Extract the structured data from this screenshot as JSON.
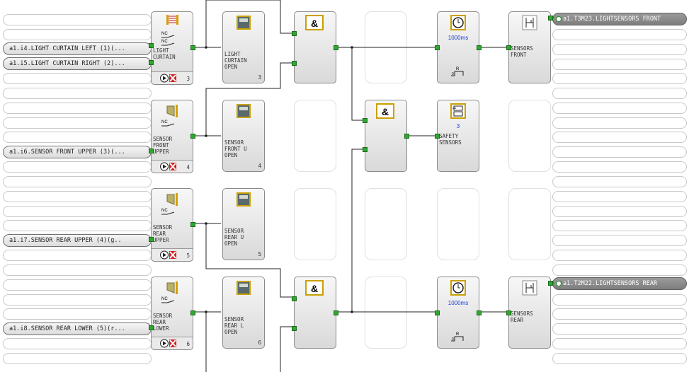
{
  "inputs": [
    {
      "label": "a1.i4.LIGHT CURTAIN LEFT  (1)(..."
    },
    {
      "label": "a1.i5.LIGHT CURTAIN RIGHT  (2)..."
    },
    {
      "label": "a1.i6.SENSOR FRONT UPPER  (3)(..."
    },
    {
      "label": "a1.i7.SENSOR REAR UPPER  (4)(g.."
    },
    {
      "label": "a1.i8.SENSOR REAR LOWER  (5)(r..."
    }
  ],
  "outputs": [
    {
      "label": "a1.T3M23.LIGHTSENSORS FRONT"
    },
    {
      "label": "a1.T2M22.LIGHTSENSORS REAR"
    }
  ],
  "sensor_blocks": [
    {
      "text": "LIGHT\nCURTAIN",
      "number": "3"
    },
    {
      "text": "SENSOR\nFRONT\nUPPER",
      "number": "4"
    },
    {
      "text": "SENSOR\nREAR\nUPPER",
      "number": "5"
    },
    {
      "text": "SENSOR\nREAR\nLOWER",
      "number": "6"
    }
  ],
  "monitor_blocks": [
    {
      "text": "LIGHT\nCURTAIN\nOPEN",
      "number": "3"
    },
    {
      "text": "SENSOR\nFRONT U\nOPEN",
      "number": "4"
    },
    {
      "text": "SENSOR\nREAR U\nOPEN",
      "number": "5"
    },
    {
      "text": "SENSOR\nREAR L\nOPEN",
      "number": "6"
    }
  ],
  "and_gates": [
    {
      "symbol": "&"
    },
    {
      "symbol": "&"
    },
    {
      "symbol": "&"
    }
  ],
  "timers": [
    {
      "value": "1000ms"
    },
    {
      "value": "1000ms"
    }
  ],
  "counter": {
    "value": "3",
    "text": "SAFETY\nSENSORS"
  },
  "output_blocks": [
    {
      "text": "SENSORS\nFRONT"
    },
    {
      "text": "SENSORS\nREAR"
    }
  ],
  "icons": {
    "sensor_nc": "nc-contact-icon",
    "monitor": "monitor-icon",
    "timer": "clock-icon",
    "counter": "counter-icon",
    "output": "relay-icon",
    "play": "play-icon",
    "bypass": "bypass-icon"
  },
  "colors": {
    "pin": "#2fa82f",
    "timer_text": "#1a3cd8",
    "gate_border": "#caa000",
    "bypass": "#cc2222"
  }
}
